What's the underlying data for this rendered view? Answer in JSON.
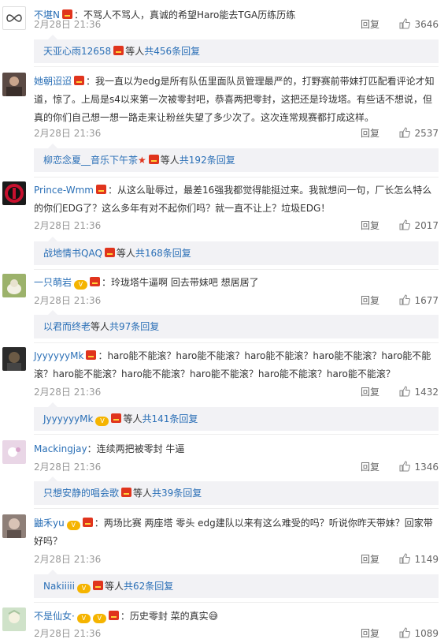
{
  "comments": [
    {
      "user": "不堪N",
      "text": "：不骂人不骂人，真诚的希望Haro能去TGA历练历练",
      "time": "2月28日 21:36",
      "reply": "回复",
      "likes": "3646",
      "sub": {
        "user": "天亚心雨12658",
        "etc": "等人",
        "count": "共456条回复"
      },
      "avatar": {
        "bg": "#ffffff",
        "icon": "infinity-icon"
      }
    },
    {
      "user": "她朝迢迢",
      "text": "：我一直以为edg是所有队伍里面队员管理最严的，打野赛前带妹打匹配看评论才知道，惊了。上局是s4以来第一次被零封吧，恭喜两把零封，这把还是玲珑塔。有些话不想说，但真的你们自己想一想一路走来让粉丝失望了多少次了。这次连常规赛都打成这样。",
      "time": "2月28日 21:36",
      "reply": "回复",
      "likes": "2537",
      "sub": {
        "user": "柳恋念夏__音乐下午茶",
        "etc": "等人",
        "count": "共192条回复"
      },
      "avatar": {
        "bg": "#5b4a44",
        "icon": "photo-icon"
      }
    },
    {
      "user": "Prince-Wmm",
      "text": "：从这么耻辱过，最差16强我都觉得能挺过来。我就想问一句，厂长怎么特么的你们EDG了？这么多年有对不起你们吗？就一直不让上？垃圾EDG！",
      "time": "2月28日 21:36",
      "reply": "回复",
      "likes": "2017",
      "sub": {
        "user": "战地情书QAQ",
        "etc": "等人",
        "count": "共168条回复"
      },
      "avatar": {
        "bg": "#1a1a1a",
        "icon": "club-logo-icon"
      }
    },
    {
      "user": "一只萌岩",
      "text": "：玲珑塔牛逼啊 回去带妹吧 想居居了",
      "time": "2月28日 21:36",
      "reply": "回复",
      "likes": "1677",
      "sub": {
        "user": "以君而终老",
        "etc": "等人",
        "count": "共97条回复"
      },
      "avatar": {
        "bg": "#9cb26b",
        "icon": "photo-icon"
      }
    },
    {
      "user": "JyyyyyyMk",
      "text": "：haro能不能滚？haro能不能滚？haro能不能滚？haro能不能滚？haro能不能滚？haro能不能滚？haro能不能滚？haro能不能滚？haro能不能滚？haro能不能滚？",
      "time": "2月28日 21:36",
      "reply": "回复",
      "likes": "1432",
      "sub": {
        "user": "JyyyyyyMk",
        "etc": "等人",
        "count": "共141条回复"
      },
      "avatar": {
        "bg": "#2b2b2b",
        "icon": "photo-icon"
      }
    },
    {
      "user": "Mackingjay",
      "text": "：连续两把被零封 牛逼",
      "time": "2月28日 21:36",
      "reply": "回复",
      "likes": "1346",
      "sub": {
        "user": "只想安静的唱会歌",
        "etc": "等人",
        "count": "共39条回复"
      },
      "avatar": {
        "bg": "#e9d6e6",
        "icon": "photo-icon"
      }
    },
    {
      "user": "鼬禾yu",
      "text": "：两场比赛 两座塔 零头 edg建队以来有这么难受的吗？听说你昨天带妹？回家带好吗？",
      "time": "2月28日 21:36",
      "reply": "回复",
      "likes": "1149",
      "sub": {
        "user": "Nakiiiii",
        "etc": "等人",
        "count": "共62条回复"
      },
      "avatar": {
        "bg": "#8e7f78",
        "icon": "photo-icon"
      }
    },
    {
      "user": "不是仙女·",
      "text": "：历史零封 菜的真实😅",
      "time": "2月28日 21:36",
      "reply": "回复",
      "likes": "1089",
      "sub": null,
      "avatar": {
        "bg": "#cfe2c9",
        "icon": "photo-icon"
      }
    }
  ]
}
